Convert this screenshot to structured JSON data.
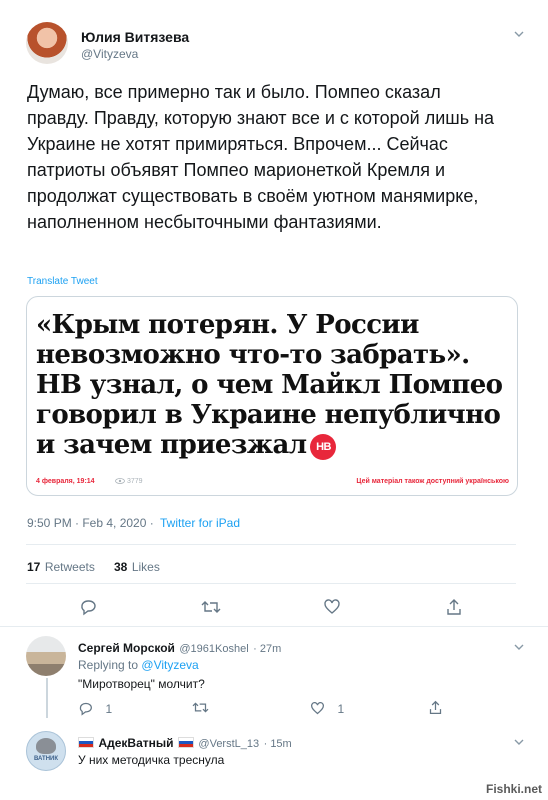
{
  "author": {
    "name": "Юлия Витязева",
    "handle": "@Vityzeva",
    "avatar_color": "#b8522c"
  },
  "tweet": {
    "text": "Думаю, все примерно так и было. Помпео сказал правду. Правду, которую знают все и с которой лишь на Украине не хотят примиряться. Впрочем... Сейчас патриоты объявят Помпео марионеткой Кремля и продолжат существовать в своём уютном манямирке, наполненном несбыточными фантазиями.",
    "translate_label": "Translate Tweet",
    "time": "9:50 PM · Feb 4, 2020 ·",
    "source": "Twitter for iPad",
    "retweets": "17",
    "retweets_label": "Retweets",
    "likes": "38",
    "likes_label": "Likes"
  },
  "card": {
    "headline": "«Крым потерян. У России невозможно что-то забрать». НВ узнал, о чем Майкл Помпео говорил в Украине непублично и зачем приезжал",
    "badge": "НВ",
    "date": "4 февраля, 19:14",
    "views": "3779",
    "language_note": "Цей матеріал також доступний українською",
    "accent_color": "#e8273b"
  },
  "replies": [
    {
      "name": "Сергей Морской",
      "handle": "@1961Koshel",
      "time": "· 27m",
      "replying_prefix": "Replying to",
      "replying_to": "@Vityzeva",
      "text": "\"Миротворец\" молчит?",
      "reply_count": "1",
      "like_count": "1"
    },
    {
      "name": "АдекВатный",
      "handle": "@VerstL_13",
      "time": "· 15m",
      "avatar_text": "ВАТНИК",
      "text": "У них методичка треснула"
    }
  ],
  "watermark": "Fishki.net",
  "colors": {
    "link": "#1da1f2",
    "muted": "#657786",
    "divider": "#e6ecf0"
  }
}
